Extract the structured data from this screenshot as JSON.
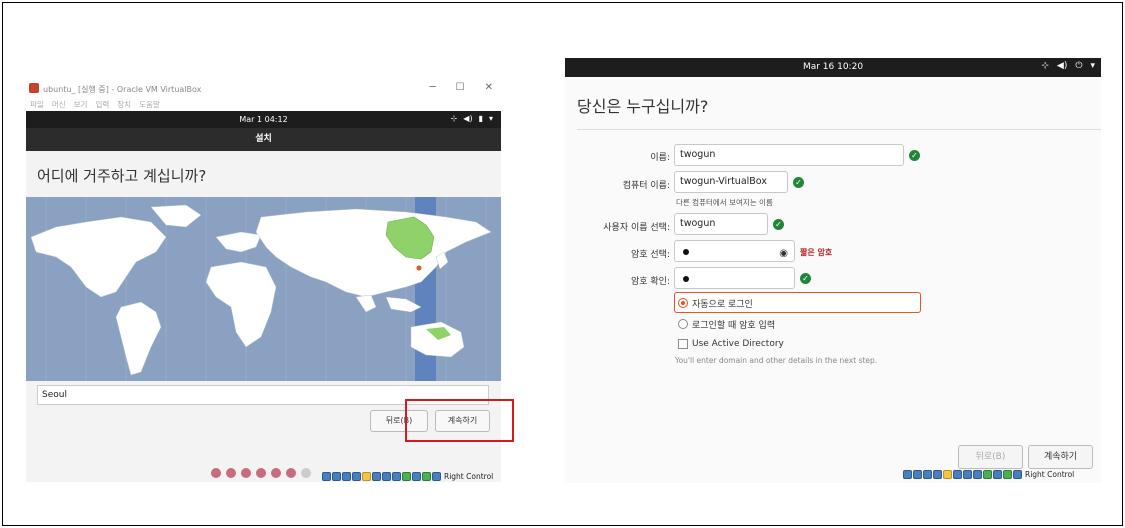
{
  "left_window": {
    "title": "ubuntu_ [실행 중] - Oracle VM VirtualBox",
    "menu": [
      "파일",
      "머신",
      "보기",
      "입력",
      "장치",
      "도움말"
    ],
    "topbar": {
      "clock": "Mar 1  04:12"
    },
    "header": "설치",
    "heading": "어디에 거주하고 계십니까?",
    "city_value": "Seoul",
    "back_button": "뒤로(B)",
    "continue_button": "계속하기",
    "statusbar_text": "Right Control",
    "progress": {
      "total_steps": 7,
      "current_step": 7
    }
  },
  "right_window": {
    "topbar": {
      "clock": "Mar 16  10:20"
    },
    "heading": "당신은 누구십니까?",
    "fields": {
      "name_label": "이름:",
      "name_value": "twogun",
      "computer_label": "컴퓨터 이름:",
      "computer_value": "twogun-VirtualBox",
      "computer_hint": "다른 컴퓨터에서 보여지는 이름",
      "username_label": "사용자 이름 선택:",
      "username_value": "twogun",
      "password_label": "암호 선택:",
      "password_strength": "짧은 암호",
      "confirm_label": "암호 확인:"
    },
    "options": {
      "auto_login": "자동으로 로그인",
      "require_password": "로그인할 때 암호 입력",
      "active_directory": "Use Active Directory",
      "ad_hint": "You'll enter domain and other details in the next step."
    },
    "back_button": "뒤로(B)",
    "continue_button": "계속하기",
    "statusbar_text": "Right Control"
  },
  "colors": {
    "accent": "#e95420",
    "check": "#22863a",
    "highlight": "#d9181c"
  }
}
